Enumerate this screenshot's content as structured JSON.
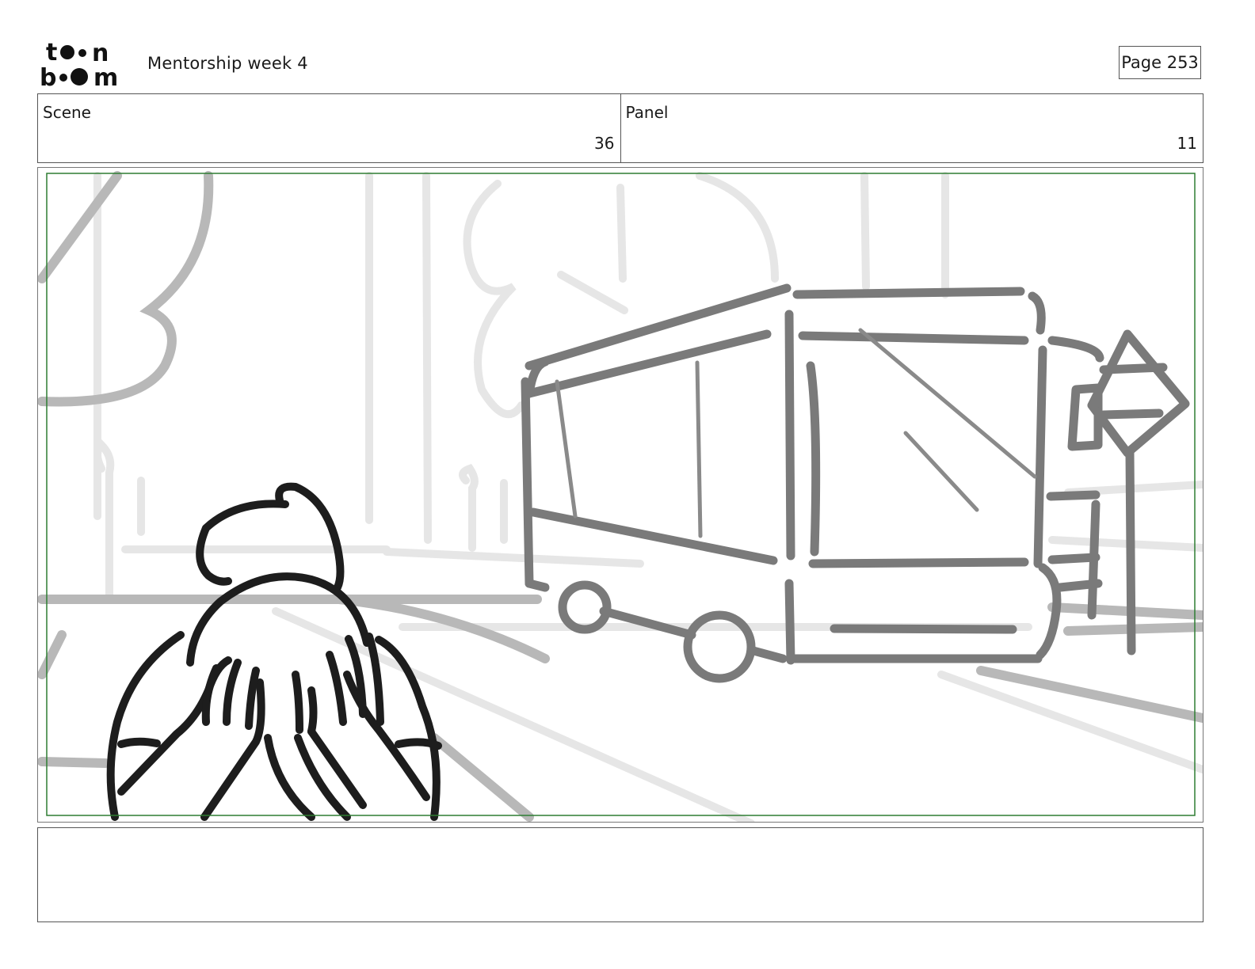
{
  "header": {
    "logo": {
      "line1": "toon",
      "line2": "boom",
      "icon": "toon-boom-logo"
    },
    "document_title": "Mentorship week 4",
    "page_label": "Page 253"
  },
  "info": {
    "scene_label": "Scene",
    "scene_value": "36",
    "panel_label": "Panel",
    "panel_value": "11"
  },
  "panel": {
    "safe_frame_color": "#2e7d32",
    "content": "storyboard-sketch"
  },
  "notes": {
    "text": ""
  }
}
